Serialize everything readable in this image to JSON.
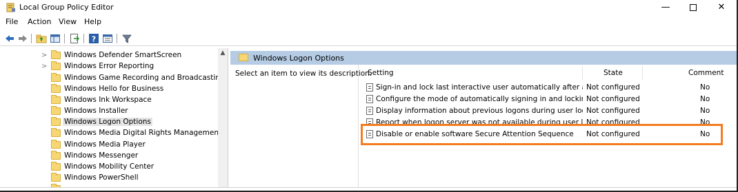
{
  "window": {
    "title": "Local Group Policy Editor",
    "controls": {
      "minimize": "—",
      "maximize": "",
      "close": "✕"
    }
  },
  "menu": [
    "File",
    "Action",
    "View",
    "Help"
  ],
  "toolbar": [
    "back-arrow-icon",
    "forward-arrow-icon",
    "up-folder-icon",
    "show-hide-tree-icon",
    "export-list-icon",
    "help-icon",
    "properties-icon",
    "filter-icon"
  ],
  "tree": {
    "items": [
      {
        "label": "Windows Defender SmartScreen",
        "expandable": true
      },
      {
        "label": "Windows Error Reporting",
        "expandable": true
      },
      {
        "label": "Windows Game Recording and Broadcasting",
        "expandable": false
      },
      {
        "label": "Windows Hello for Business",
        "expandable": false
      },
      {
        "label": "Windows Ink Workspace",
        "expandable": false
      },
      {
        "label": "Windows Installer",
        "expandable": false
      },
      {
        "label": "Windows Logon Options",
        "expandable": false,
        "selected": true
      },
      {
        "label": "Windows Media Digital Rights Management",
        "expandable": false
      },
      {
        "label": "Windows Media Player",
        "expandable": false
      },
      {
        "label": "Windows Messenger",
        "expandable": false
      },
      {
        "label": "Windows Mobility Center",
        "expandable": false
      },
      {
        "label": "Windows PowerShell",
        "expandable": false
      }
    ]
  },
  "details": {
    "header": "Windows Logon Options",
    "description": "Select an item to view its description.",
    "columns": {
      "setting": "Setting",
      "state": "State",
      "comment": "Comment"
    },
    "rows": [
      {
        "setting": "Sign-in and lock last interactive user automatically after a re...",
        "state": "Not configured",
        "comment": "No"
      },
      {
        "setting": "Configure the mode of automatically signing in and locking...",
        "state": "Not configured",
        "comment": "No"
      },
      {
        "setting": "Display information about previous logons during user logon",
        "state": "Not configured",
        "comment": "No"
      },
      {
        "setting": "Report when logon server was not available during user logon",
        "state": "Not configured",
        "comment": "No"
      },
      {
        "setting": "Disable or enable software Secure Attention Sequence",
        "state": "Not configured",
        "comment": "No"
      }
    ],
    "highlight_color": "#f47b20"
  }
}
